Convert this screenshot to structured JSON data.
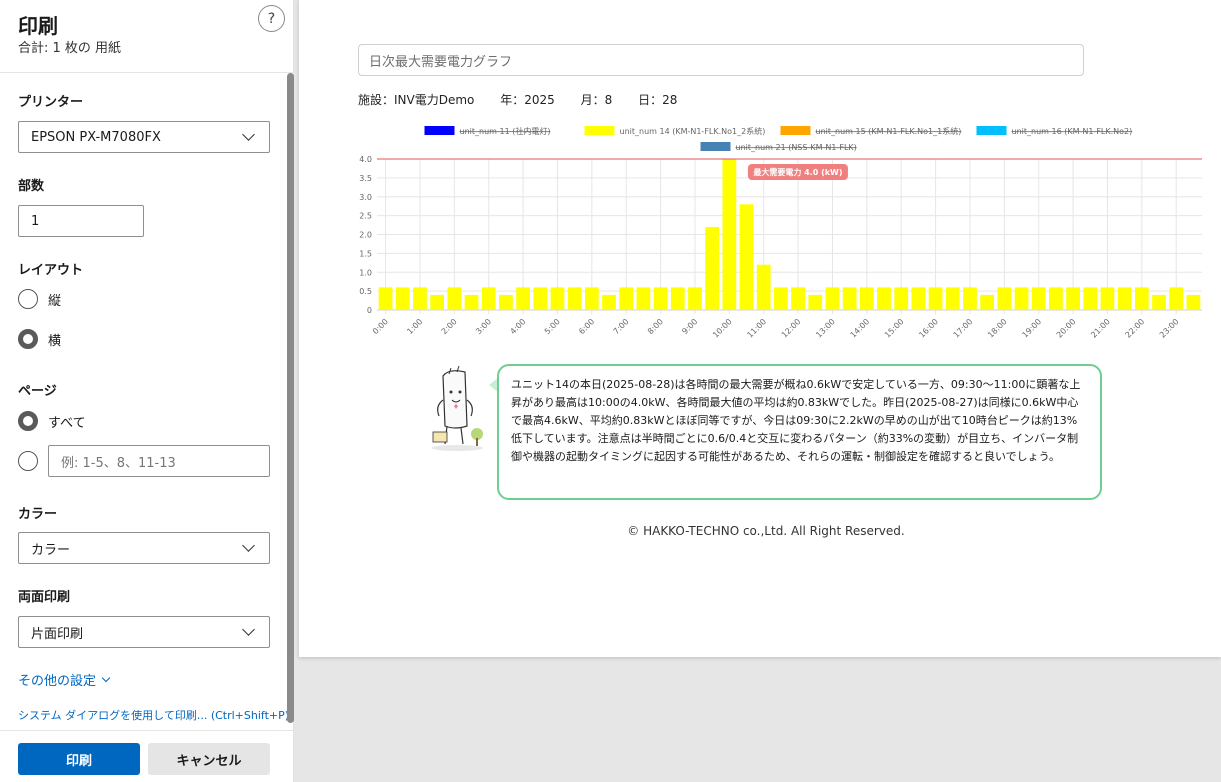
{
  "panel": {
    "title": "印刷",
    "subtitle": "合計: 1 枚の 用紙",
    "help_label": "?",
    "printer_label": "プリンター",
    "printer_value": "EPSON PX-M7080FX",
    "copies_label": "部数",
    "copies_value": "1",
    "layout_label": "レイアウト",
    "layout_options": [
      {
        "label": "縦",
        "selected": false
      },
      {
        "label": "横",
        "selected": true
      }
    ],
    "pages_label": "ページ",
    "pages_all_label": "すべて",
    "pages_all_selected": true,
    "pages_range_placeholder": "例: 1-5、8、11-13",
    "color_label": "カラー",
    "color_value": "カラー",
    "duplex_label": "両面印刷",
    "duplex_value": "片面印刷",
    "more_settings": "その他の設定",
    "system_dialog": "システム ダイアログを使用して印刷... (Ctrl+Shift+P)",
    "print_button": "印刷",
    "cancel_button": "キャンセル"
  },
  "preview": {
    "graph_title_placeholder": "日次最大需要電力グラフ",
    "facility": "施設：INV電力Demo",
    "year": "年：2025",
    "month": "月：8",
    "day": "日：28",
    "comment": "ユニット14の本日(2025-08-28)は各時間の最大需要が概ね0.6kWで安定している一方、09:30～11:00に顕著な上昇があり最高は10:00の4.0kW、各時間最大値の平均は約0.83kWでした。昨日(2025-08-27)は同様に0.6kW中心で最高4.6kW、平均約0.83kWとほぼ同等ですが、今日は09:30に2.2kWの早めの山が出て10時台ピークは約13%低下しています。注意点は半時間ごとに0.6/0.4と交互に変わるパターン（約33%の変動）が目立ち、インバータ制御や機器の起動タイミングに起因する可能性があるため、それらの運転・制御設定を確認すると良いでしょう。",
    "copyright": "© HAKKO-TECHNO co.,Ltd. All Right Reserved."
  },
  "chart_data": {
    "type": "bar",
    "categories": [
      "0:00",
      "0:30",
      "1:00",
      "1:30",
      "2:00",
      "2:30",
      "3:00",
      "3:30",
      "4:00",
      "4:30",
      "5:00",
      "5:30",
      "6:00",
      "6:30",
      "7:00",
      "7:30",
      "8:00",
      "8:30",
      "9:00",
      "9:30",
      "10:00",
      "10:30",
      "11:00",
      "11:30",
      "12:00",
      "12:30",
      "13:00",
      "13:30",
      "14:00",
      "14:30",
      "15:00",
      "15:30",
      "16:00",
      "16:30",
      "17:00",
      "17:30",
      "18:00",
      "18:30",
      "19:00",
      "19:30",
      "20:00",
      "20:30",
      "21:00",
      "21:30",
      "22:00",
      "22:30",
      "23:00",
      "23:30"
    ],
    "tick_labels": [
      "0:00",
      "1:00",
      "2:00",
      "3:00",
      "4:00",
      "5:00",
      "6:00",
      "7:00",
      "8:00",
      "9:00",
      "10:00",
      "11:00",
      "12:00",
      "13:00",
      "14:00",
      "15:00",
      "16:00",
      "17:00",
      "18:00",
      "19:00",
      "20:00",
      "21:00",
      "22:00",
      "23:00"
    ],
    "series": [
      {
        "name": "unit_num 11 (社内電灯)",
        "color": "#0000ff",
        "hidden": true,
        "values": []
      },
      {
        "name": "unit_num 14 (KM-N1-FLK.No1_2系統)",
        "color": "#ffff00",
        "hidden": false,
        "values": [
          0.6,
          0.6,
          0.6,
          0.4,
          0.6,
          0.4,
          0.6,
          0.4,
          0.6,
          0.6,
          0.6,
          0.6,
          0.6,
          0.4,
          0.6,
          0.6,
          0.6,
          0.6,
          0.6,
          2.2,
          4.0,
          2.8,
          1.2,
          0.6,
          0.6,
          0.4,
          0.6,
          0.6,
          0.6,
          0.6,
          0.6,
          0.6,
          0.6,
          0.6,
          0.6,
          0.4,
          0.6,
          0.6,
          0.6,
          0.6,
          0.6,
          0.6,
          0.6,
          0.6,
          0.6,
          0.4,
          0.6,
          0.4
        ]
      },
      {
        "name": "unit_num 15 (KM-N1-FLK.No1_1系統)",
        "color": "#ffa500",
        "hidden": true,
        "values": []
      },
      {
        "name": "unit_num 16 (KM-N1-FLK.No2)",
        "color": "#00bfff",
        "hidden": true,
        "values": []
      },
      {
        "name": "unit_num 21 (NSS-KM-N1-FLK)",
        "color": "#4682b4",
        "hidden": true,
        "values": []
      }
    ],
    "y_ticks": [
      "0",
      "0.5",
      "1.0",
      "1.5",
      "2.0",
      "2.5",
      "3.0",
      "3.5",
      "4.0"
    ],
    "ylim": [
      0,
      4.0
    ],
    "max_line": {
      "value": 4.0,
      "label": "最大需要電力 4.0 (kW)",
      "color": "#e05555"
    },
    "grid": true,
    "legend_position": "top-center"
  }
}
